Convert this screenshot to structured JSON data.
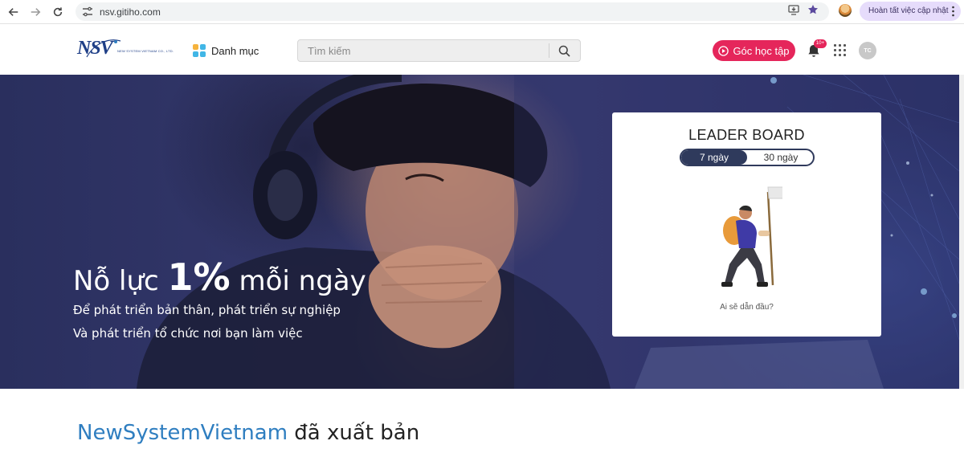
{
  "browser": {
    "url": "nsv.gitiho.com",
    "update_label": "Hoàn tất việc cập nhật"
  },
  "header": {
    "logo_mark": "NSV",
    "logo_text": "NEW SYSTEM VIETNAM CO., LTD.",
    "category_label": "Danh mục",
    "search_placeholder": "Tìm kiếm",
    "study_button_label": "Góc học tập",
    "notification_badge": "10+",
    "avatar_initials": "TC"
  },
  "hero": {
    "title_part1": "Nỗ lực ",
    "title_big": "1%",
    "title_part2": " mỗi ngày",
    "line1": "Để phát triển bản thân, phát triển sự nghiệp",
    "line2": "Và phát triển tổ chức nơi bạn làm việc"
  },
  "leaderboard": {
    "title": "LEADER BOARD",
    "tab_7": "7 ngày",
    "tab_30": "30 ngày",
    "selected_tab": "7 ngày",
    "question": "Ai sẽ dẫn đầu?"
  },
  "section": {
    "brand": "NewSystemVietnam",
    "rest": " đã xuất bản"
  },
  "colors": {
    "accent_pink": "#e5265b",
    "brand_blue": "#2f7ec0",
    "toggle_navy": "#2f3a5c",
    "update_pill": "#e6dcfb"
  }
}
